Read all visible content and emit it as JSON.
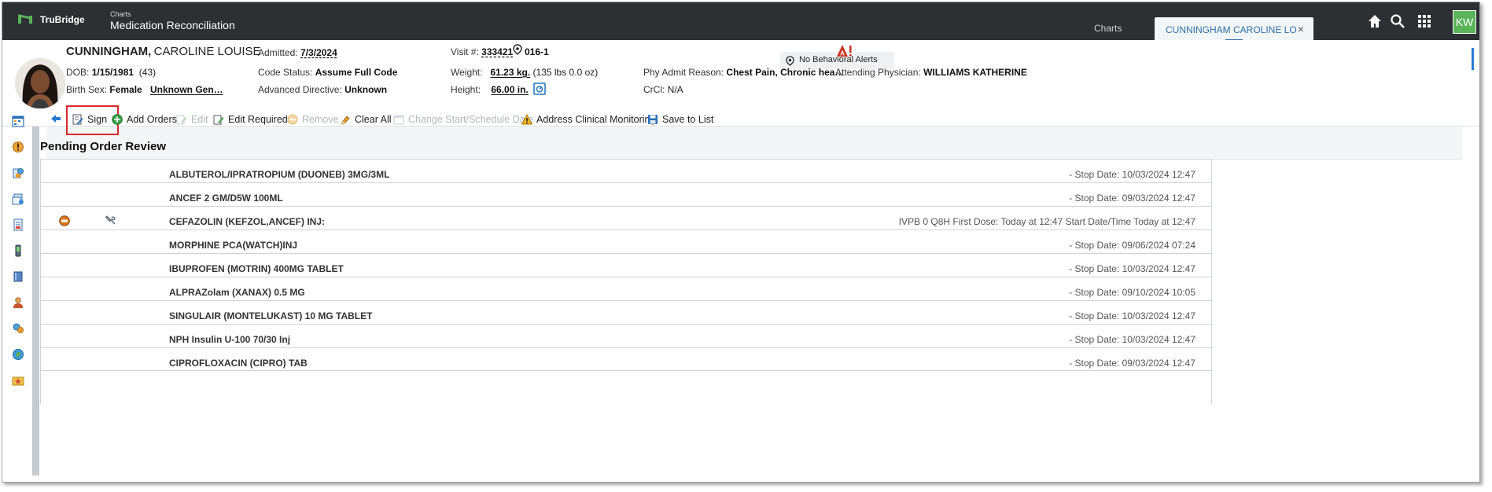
{
  "app": {
    "brand": "TruBridge",
    "module": "Charts",
    "title": "Medication Reconciliation"
  },
  "tabs": {
    "charts": "Charts",
    "patient": "CUNNINGHAM CAROLINE LO",
    "close": "×"
  },
  "user": {
    "initials": "KW"
  },
  "patient": {
    "last_name": "CUNNINGHAM,",
    "first_name": "CAROLINE LOUISE",
    "dob_label": "DOB:",
    "dob": "1/15/1981",
    "age": "(43)",
    "birth_sex_label": "Birth Sex:",
    "birth_sex": "Female",
    "gender": "Unknown Gen…",
    "admitted_label": "Admitted:",
    "admitted": "7/3/2024",
    "code_status_label": "Code Status:",
    "code_status": "Assume Full Code",
    "adv_directive_label": "Advanced Directive:",
    "adv_directive": "Unknown",
    "visit_label": "Visit #:",
    "visit": "333421",
    "room": "016-1",
    "weight_label": "Weight:",
    "weight": "61.23 kg.",
    "weight_lbs": "(135 lbs 0.0 oz)",
    "height_label": "Height:",
    "height": "66.00 in.",
    "behavioral_alerts": "No Behavioral Alerts",
    "admit_reason_label": "Phy Admit Reason:",
    "admit_reason": "Chest Pain, Chronic hea…",
    "crcl_label": "CrCl:",
    "crcl": "N/A",
    "physician_label": "Attending Physician:",
    "physician": "WILLIAMS KATHERINE"
  },
  "toolbar": {
    "sign": "Sign",
    "add_orders": "Add Orders",
    "edit": "Edit",
    "edit_required": "Edit Required",
    "remove": "Remove",
    "clear_all": "Clear All",
    "change_date": "Change Start/Schedule Date",
    "address_monitoring": "Address Clinical Monitoring",
    "save_to_list": "Save to List"
  },
  "section": {
    "title": "Pending Order Review"
  },
  "orders": [
    {
      "name": "ALBUTEROL/IPRATROPIUM (DUONEB) 3MG/3ML",
      "info": "- Stop Date: 10/03/2024 12:47"
    },
    {
      "name": "ANCEF 2 GM/D5W 100ML",
      "info": "- Stop Date: 09/03/2024 12:47"
    },
    {
      "name": "CEFAZOLIN (KEFZOL,ANCEF) INJ:",
      "info": "IVPB 0 Q8H First Dose: Today at 12:47 Start Date/Time Today at 12:47"
    },
    {
      "name": "MORPHINE PCA(WATCH)INJ",
      "info": "- Stop Date: 09/06/2024 07:24"
    },
    {
      "name": "IBUPROFEN (MOTRIN) 400MG TABLET",
      "info": "- Stop Date: 10/03/2024 12:47"
    },
    {
      "name": "ALPRAZolam (XANAX) 0.5 MG",
      "info": "- Stop Date: 09/10/2024 10:05"
    },
    {
      "name": "SINGULAIR (MONTELUKAST) 10 MG TABLET",
      "info": "- Stop Date: 10/03/2024 12:47"
    },
    {
      "name": "NPH Insulin U-100 70/30 Inj",
      "info": "- Stop Date: 10/03/2024 12:47"
    },
    {
      "name": "CIPROFLOXACIN (CIPRO) TAB",
      "info": "- Stop Date: 09/03/2024 12:47"
    }
  ]
}
